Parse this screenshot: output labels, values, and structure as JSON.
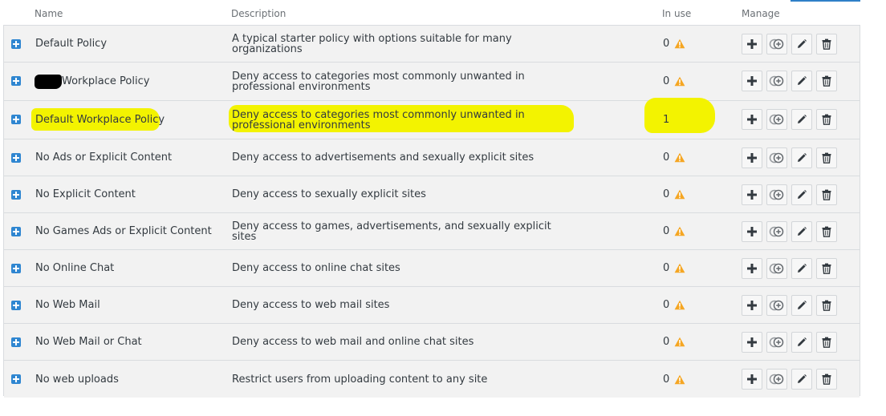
{
  "header": {
    "name": "Name",
    "description": "Description",
    "in_use": "In use",
    "manage": "Manage"
  },
  "colors": {
    "accent": "#2f86d1",
    "warning": "#f5a623",
    "highlight": "#f3f300"
  },
  "icons": {
    "expand": "expand-plus-icon",
    "warning": "warning-triangle-icon",
    "add": "plus-icon",
    "clone": "clone-icon",
    "edit": "pencil-icon",
    "delete": "trash-icon"
  },
  "rows": [
    {
      "name": "Default Policy",
      "description": "A typical starter policy with options suitable for many organizations",
      "in_use": "0",
      "warning": true
    },
    {
      "name": "Workplace Policy",
      "description": "Deny access to categories most commonly unwanted in professional environments",
      "in_use": "0",
      "warning": true,
      "redacted_prefix": true
    },
    {
      "name": "Default Workplace Policy",
      "description": "Deny access to categories most commonly unwanted in professional environments",
      "in_use": "1",
      "warning": false,
      "highlighted": true
    },
    {
      "name": "No Ads or Explicit Content",
      "description": "Deny access to advertisements and sexually explicit sites",
      "in_use": "0",
      "warning": true
    },
    {
      "name": "No Explicit Content",
      "description": "Deny access to sexually explicit sites",
      "in_use": "0",
      "warning": true
    },
    {
      "name": "No Games Ads or Explicit Content",
      "description": "Deny access to games, advertisements, and sexually explicit sites",
      "in_use": "0",
      "warning": true
    },
    {
      "name": "No Online Chat",
      "description": "Deny access to online chat sites",
      "in_use": "0",
      "warning": true
    },
    {
      "name": "No Web Mail",
      "description": "Deny access to web mail sites",
      "in_use": "0",
      "warning": true
    },
    {
      "name": "No Web Mail or Chat",
      "description": "Deny access to web mail and online chat sites",
      "in_use": "0",
      "warning": true
    },
    {
      "name": "No web uploads",
      "description": "Restrict users from uploading content to any site",
      "in_use": "0",
      "warning": true
    }
  ]
}
